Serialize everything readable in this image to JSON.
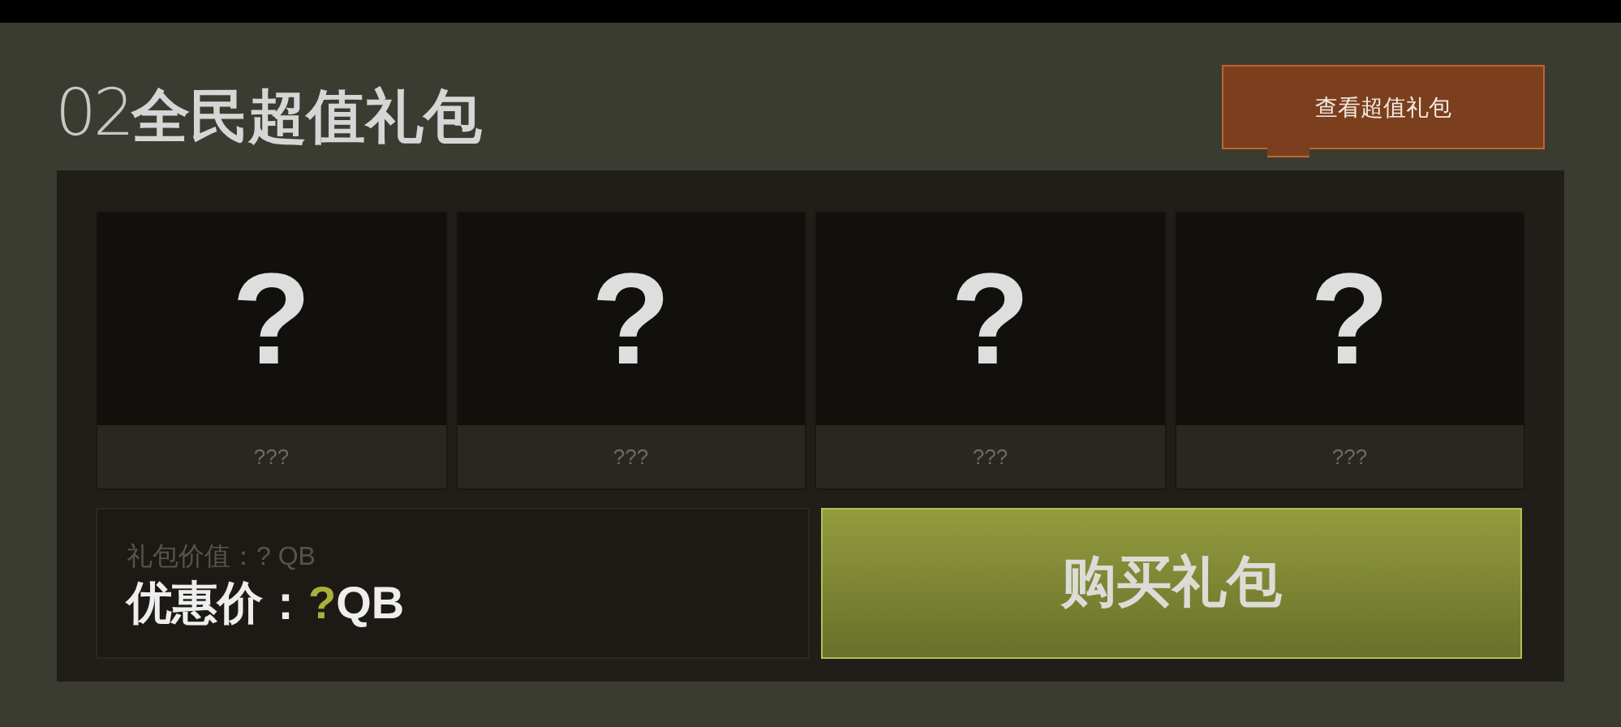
{
  "header": {
    "number": "02",
    "title": "全民超值礼包",
    "view_button": "查看超值礼包"
  },
  "items": [
    {
      "icon": "?",
      "caption": "???"
    },
    {
      "icon": "?",
      "caption": "???"
    },
    {
      "icon": "?",
      "caption": "???"
    },
    {
      "icon": "?",
      "caption": "???"
    }
  ],
  "price": {
    "original": "礼包价值：? QB",
    "label": "优惠价：",
    "amount": "?",
    "unit": "QB"
  },
  "buy_button": "购买礼包"
}
